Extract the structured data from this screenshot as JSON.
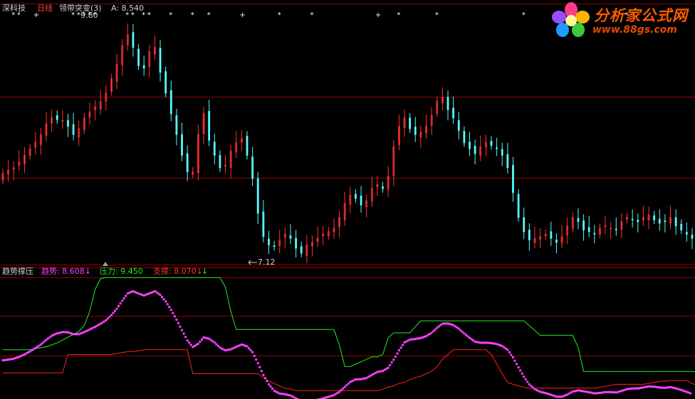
{
  "header": {
    "stock_name": "深科技",
    "period": "日线",
    "indicator_label": "领带突变(3)",
    "a_label": "A: 8.540",
    "high_marker": "9.80",
    "low_marker": "7.12"
  },
  "lower_panel": {
    "name": "趋势撑压",
    "trend_label": "趋势: 8.608↓",
    "pressure_label": "压力: 9.450",
    "support_label": "支撑: 8.070↓"
  },
  "logo": {
    "text": "分析家公式网",
    "url": "www.88gs.com"
  },
  "colors": {
    "up": "#ff3232",
    "down": "#54fcfc",
    "trend": "#ff40ff",
    "pressure": "#22ee22",
    "support": "#ff2020",
    "grid": "#900000"
  },
  "chart_data": [
    {
      "type": "candlestick",
      "title": "",
      "ylim": [
        7.0,
        10.0
      ],
      "annotations": [
        {
          "label": "9.80",
          "kind": "high"
        },
        {
          "label": "7.12",
          "kind": "low"
        }
      ],
      "close": [
        8.08,
        8.12,
        8.15,
        8.22,
        8.3,
        8.38,
        8.46,
        8.55,
        8.68,
        8.75,
        8.73,
        8.72,
        8.65,
        8.55,
        8.62,
        8.75,
        8.82,
        8.88,
        8.95,
        9.05,
        9.22,
        9.4,
        9.62,
        9.75,
        9.6,
        9.38,
        9.35,
        9.55,
        9.6,
        9.3,
        9.05,
        8.8,
        8.55,
        8.3,
        8.1,
        8.1,
        8.55,
        8.8,
        8.48,
        8.3,
        8.15,
        8.18,
        8.35,
        8.45,
        8.5,
        8.3,
        8.02,
        7.6,
        7.32,
        7.22,
        7.2,
        7.28,
        7.35,
        7.3,
        7.18,
        7.12,
        7.22,
        7.25,
        7.3,
        7.35,
        7.38,
        7.42,
        7.55,
        7.72,
        7.82,
        7.78,
        7.7,
        7.75,
        7.9,
        7.95,
        7.9,
        8.05,
        8.4,
        8.65,
        8.75,
        8.62,
        8.55,
        8.58,
        8.65,
        8.78,
        8.95,
        9.0,
        8.85,
        8.75,
        8.6,
        8.45,
        8.38,
        8.32,
        8.4,
        8.45,
        8.42,
        8.38,
        8.3,
        8.15,
        7.85,
        7.55,
        7.38,
        7.28,
        7.3,
        7.32,
        7.35,
        7.3,
        7.25,
        7.32,
        7.45,
        7.55,
        7.5,
        7.4,
        7.38,
        7.35,
        7.42,
        7.45,
        7.42,
        7.4,
        7.5,
        7.55,
        7.52,
        7.5,
        7.55,
        7.58,
        7.52,
        7.48,
        7.5,
        7.55,
        7.45,
        7.4,
        7.35,
        7.3
      ],
      "pressure": [
        8.3,
        8.3,
        8.3,
        8.3,
        8.3,
        8.3,
        8.32,
        8.34,
        8.36,
        8.4,
        8.44,
        8.5,
        8.56,
        8.62,
        8.68,
        8.8,
        9.1,
        9.55,
        9.78,
        9.8,
        9.8,
        9.8,
        9.8,
        9.8,
        9.8,
        9.8,
        9.8,
        9.8,
        9.8,
        9.8,
        9.8,
        9.8,
        9.8,
        9.8,
        9.8,
        9.8,
        9.8,
        9.8,
        9.8,
        9.8,
        9.8,
        9.6,
        9.1,
        8.72,
        8.72,
        8.72,
        8.72,
        8.72,
        8.72,
        8.72,
        8.72,
        8.72,
        8.72,
        8.72,
        8.72,
        8.72,
        8.72,
        8.72,
        8.72,
        8.72,
        8.72,
        8.72,
        8.4,
        7.95,
        7.95,
        8.0,
        8.05,
        8.1,
        8.15,
        8.15,
        8.2,
        8.55,
        8.65,
        8.65,
        8.65,
        8.65,
        8.78,
        8.9,
        8.9,
        8.9,
        8.9,
        8.9,
        8.9,
        8.9,
        8.9,
        8.9,
        8.9,
        8.9,
        8.9,
        8.9,
        8.9,
        8.9,
        8.9,
        8.9,
        8.9,
        8.9,
        8.9,
        8.8,
        8.7,
        8.6,
        8.6,
        8.6,
        8.6,
        8.6,
        8.6,
        8.6,
        8.35,
        7.85,
        7.85,
        7.85,
        7.85,
        7.85,
        7.85,
        7.85,
        7.85,
        7.85,
        7.85,
        7.85,
        7.85,
        7.85,
        7.85,
        7.85,
        7.85,
        7.85,
        7.85,
        7.85,
        7.85,
        7.85,
        7.84
      ],
      "support": [
        7.82,
        7.82,
        7.82,
        7.82,
        7.82,
        7.82,
        7.82,
        7.82,
        7.82,
        7.82,
        7.82,
        7.82,
        8.2,
        8.2,
        8.2,
        8.2,
        8.2,
        8.2,
        8.2,
        8.2,
        8.2,
        8.22,
        8.24,
        8.26,
        8.26,
        8.28,
        8.3,
        8.3,
        8.3,
        8.3,
        8.3,
        8.3,
        8.3,
        8.3,
        8.3,
        7.8,
        7.8,
        7.8,
        7.8,
        7.8,
        7.8,
        7.8,
        7.8,
        7.8,
        7.8,
        7.8,
        7.8,
        7.8,
        7.72,
        7.65,
        7.6,
        7.55,
        7.5,
        7.48,
        7.45,
        7.45,
        7.45,
        7.45,
        7.45,
        7.45,
        7.45,
        7.45,
        7.45,
        7.45,
        7.45,
        7.45,
        7.45,
        7.45,
        7.45,
        7.45,
        7.48,
        7.52,
        7.55,
        7.6,
        7.62,
        7.68,
        7.72,
        7.75,
        7.8,
        7.85,
        7.95,
        8.1,
        8.2,
        8.3,
        8.3,
        8.3,
        8.3,
        8.3,
        8.3,
        8.3,
        8.2,
        8.0,
        7.8,
        7.62,
        7.58,
        7.55,
        7.52,
        7.5,
        7.5,
        7.5,
        7.5,
        7.5,
        7.5,
        7.5,
        7.5,
        7.5,
        7.5,
        7.5,
        7.5,
        7.5,
        7.52,
        7.54,
        7.56,
        7.58,
        7.58,
        7.58,
        7.58,
        7.58,
        7.58,
        7.6,
        7.62,
        7.64,
        7.65,
        7.66,
        7.66,
        7.66,
        7.66,
        7.6,
        7.56,
        7.55,
        7.54
      ],
      "trend_last": 8.608,
      "pressure_last": 9.45,
      "support_last": 8.07
    }
  ]
}
